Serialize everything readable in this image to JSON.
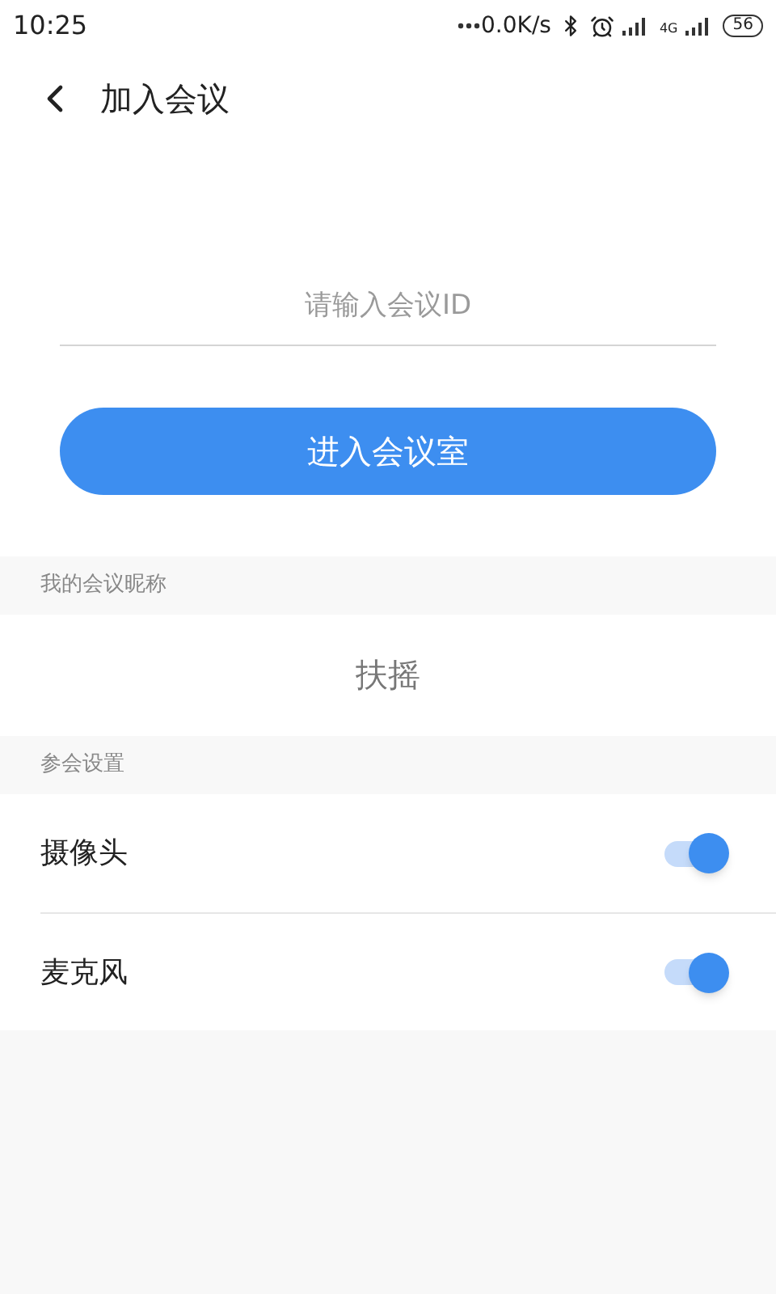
{
  "status_bar": {
    "time": "10:25",
    "network_speed": "0.0K/s",
    "network_type": "4G",
    "battery": "56"
  },
  "header": {
    "title": "加入会议"
  },
  "meeting_id": {
    "placeholder": "请输入会议ID"
  },
  "enter_button": {
    "label": "进入会议室"
  },
  "nickname_section": {
    "title": "我的会议昵称",
    "value": "扶摇"
  },
  "settings_section": {
    "title": "参会设置",
    "items": [
      {
        "label": "摄像头",
        "on": true
      },
      {
        "label": "麦克风",
        "on": true
      }
    ]
  }
}
